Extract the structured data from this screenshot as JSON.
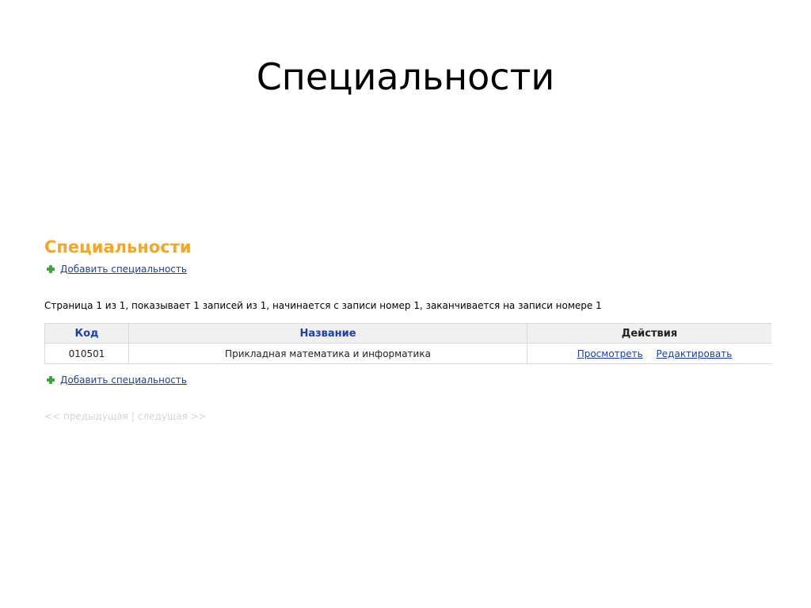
{
  "slide": {
    "title": "Специальности"
  },
  "page": {
    "heading": "Специальности",
    "add_link": "Добавить специальность",
    "page_info": "Страница 1 из 1, показывает 1 записей из 1, начинается с записи номер 1, заканчивается на записи номере 1",
    "colors": {
      "heading": "#f5a623",
      "link": "#1c3fa8",
      "add_icon": "#3aa63a"
    }
  },
  "table": {
    "headers": {
      "code": "Код",
      "name": "Название",
      "actions": "Действия"
    },
    "rows": [
      {
        "code": "010501",
        "name": "Прикладная математика и информатика",
        "view": "Просмотреть",
        "edit": "Редактировать"
      }
    ]
  },
  "pager": {
    "prev": "<< предыдущая",
    "separator": "|",
    "next": "следущая >>"
  },
  "icons": {
    "add": "plus-icon"
  }
}
